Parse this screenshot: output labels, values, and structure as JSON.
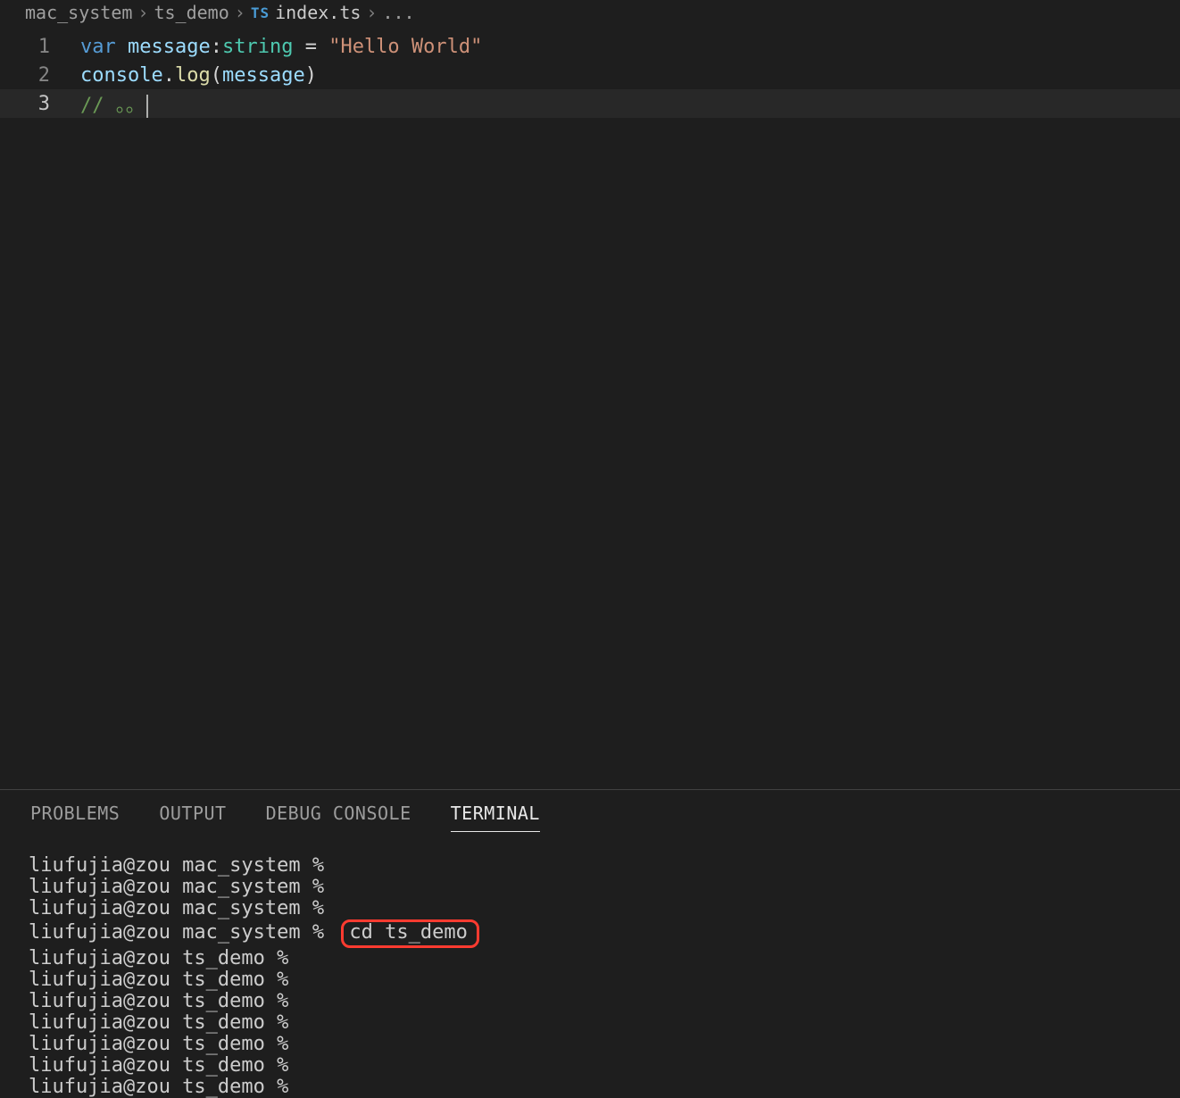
{
  "breadcrumb": {
    "items": [
      "mac_system",
      "ts_demo",
      "index.ts",
      "..."
    ],
    "fileBadge": "TS"
  },
  "editor": {
    "lines": [
      {
        "num": "1",
        "tokens": [
          {
            "t": "var",
            "c": "tok-keyword"
          },
          {
            "t": " ",
            "c": ""
          },
          {
            "t": "message",
            "c": "tok-var"
          },
          {
            "t": ":",
            "c": "tok-op"
          },
          {
            "t": "string",
            "c": "tok-type"
          },
          {
            "t": " = ",
            "c": "tok-op"
          },
          {
            "t": "\"Hello World\"",
            "c": "tok-string"
          }
        ]
      },
      {
        "num": "2",
        "tokens": [
          {
            "t": "console",
            "c": "tok-obj"
          },
          {
            "t": ".",
            "c": "tok-op"
          },
          {
            "t": "log",
            "c": "tok-method"
          },
          {
            "t": "(",
            "c": "tok-paren"
          },
          {
            "t": "message",
            "c": "tok-var"
          },
          {
            "t": ")",
            "c": "tok-paren"
          }
        ]
      },
      {
        "num": "3",
        "active": true,
        "cursor": true,
        "tokens": [
          {
            "t": "// 。。",
            "c": "tok-comment"
          }
        ]
      }
    ]
  },
  "panel": {
    "tabs": [
      {
        "label": "PROBLEMS",
        "active": false
      },
      {
        "label": "OUTPUT",
        "active": false
      },
      {
        "label": "DEBUG CONSOLE",
        "active": false
      },
      {
        "label": "TERMINAL",
        "active": true
      }
    ]
  },
  "terminal": {
    "lines": [
      {
        "prompt": "liufujia@zou mac_system % ",
        "cmd": ""
      },
      {
        "prompt": "liufujia@zou mac_system % ",
        "cmd": ""
      },
      {
        "prompt": "liufujia@zou mac_system % ",
        "cmd": ""
      },
      {
        "prompt": "liufujia@zou mac_system % ",
        "cmd": "cd ts_demo",
        "highlight": true
      },
      {
        "prompt": "liufujia@zou ts_demo % ",
        "cmd": ""
      },
      {
        "prompt": "liufujia@zou ts_demo % ",
        "cmd": ""
      },
      {
        "prompt": "liufujia@zou ts_demo % ",
        "cmd": ""
      },
      {
        "prompt": "liufujia@zou ts_demo % ",
        "cmd": ""
      },
      {
        "prompt": "liufujia@zou ts_demo % ",
        "cmd": ""
      },
      {
        "prompt": "liufujia@zou ts_demo % ",
        "cmd": ""
      },
      {
        "prompt": "liufujia@zou ts_demo % ",
        "cmd": ""
      }
    ]
  }
}
